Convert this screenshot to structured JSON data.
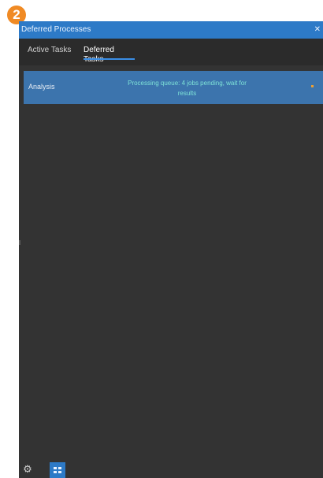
{
  "step_badge": "2",
  "window": {
    "title": "Deferred Processes",
    "pin_icon": "pin-icon"
  },
  "tabs": [
    {
      "label": "Active Tasks",
      "selected": false
    },
    {
      "label": "Deferred Tasks",
      "selected": true
    }
  ],
  "rows": [
    {
      "name": "Analysis",
      "description": "Processing queue: 4 jobs pending, wait for",
      "description_line2": "results"
    }
  ],
  "bottom": {
    "settings_icon": "gear-icon",
    "view_icon": "grid-icon"
  },
  "colors": {
    "accent": "#2d7ac7",
    "panel_bg": "#333333",
    "selected_row": "#3c74ad",
    "badge": "#f08a24"
  }
}
